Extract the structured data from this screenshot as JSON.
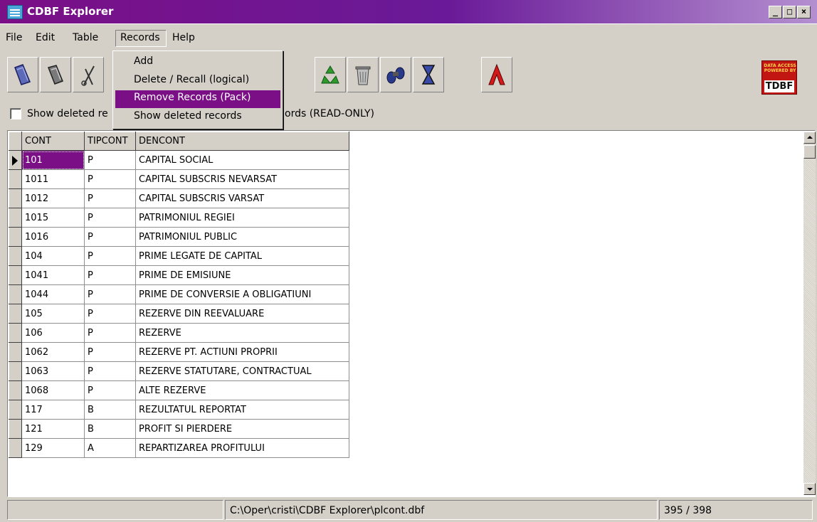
{
  "window": {
    "title": "CDBF Explorer"
  },
  "menubar": {
    "items": [
      "File",
      "Edit",
      "Table",
      "Records",
      "Help"
    ]
  },
  "records_menu": {
    "items": [
      "Add",
      "Delete / Recall (logical)",
      "Remove Records (Pack)",
      "Show deleted records"
    ],
    "highlighted_index": 2
  },
  "toolbar": {
    "buttons": [
      "open-icon",
      "close-file-icon",
      "cut-icon",
      "recycle-icon",
      "bin-icon",
      "binoculars-icon",
      "hourglass-icon",
      "text-editor-icon"
    ],
    "logo": {
      "small": "DATA ACCESS POWERED BY",
      "brand": "TDBF"
    }
  },
  "options": {
    "show_deleted_label": "Show deleted re",
    "readonly_label": "ords (READ-ONLY)"
  },
  "grid": {
    "columns": [
      "CONT",
      "TIPCONT",
      "DENCONT"
    ],
    "rows": [
      [
        "101",
        "P",
        "CAPITAL SOCIAL"
      ],
      [
        "1011",
        "P",
        "CAPITAL SUBSCRIS NEVARSAT"
      ],
      [
        "1012",
        "P",
        "CAPITAL SUBSCRIS VARSAT"
      ],
      [
        "1015",
        "P",
        "PATRIMONIUL REGIEI"
      ],
      [
        "1016",
        "P",
        "PATRIMONIUL PUBLIC"
      ],
      [
        "104",
        "P",
        "PRIME LEGATE DE CAPITAL"
      ],
      [
        "1041",
        "P",
        "PRIME DE EMISIUNE"
      ],
      [
        "1044",
        "P",
        "PRIME DE CONVERSIE A OBLIGATIUNI"
      ],
      [
        "105",
        "P",
        "REZERVE  DIN REEVALUARE"
      ],
      [
        "106",
        "P",
        "REZERVE"
      ],
      [
        "1062",
        "P",
        "REZERVE PT. ACTIUNI PROPRII"
      ],
      [
        "1063",
        "P",
        "REZERVE STATUTARE, CONTRACTUAL"
      ],
      [
        "1068",
        "P",
        "ALTE REZERVE"
      ],
      [
        "117",
        "B",
        "REZULTATUL REPORTAT"
      ],
      [
        "121",
        "B",
        "PROFIT SI PIERDERE"
      ],
      [
        "129",
        "A",
        "REPARTIZAREA PROFITULUI"
      ]
    ],
    "selected_row": 0
  },
  "status": {
    "path": "C:\\Oper\\cristi\\CDBF Explorer\\plcont.dbf",
    "position": "395 / 398"
  },
  "colors": {
    "accent": "#7a0f86",
    "face": "#d4d0c8"
  }
}
